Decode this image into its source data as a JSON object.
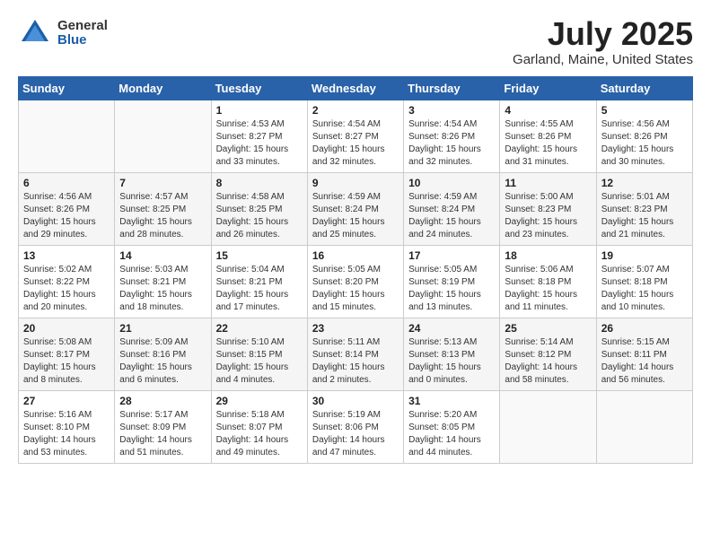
{
  "header": {
    "logo_general": "General",
    "logo_blue": "Blue",
    "title": "July 2025",
    "subtitle": "Garland, Maine, United States"
  },
  "days_of_week": [
    "Sunday",
    "Monday",
    "Tuesday",
    "Wednesday",
    "Thursday",
    "Friday",
    "Saturday"
  ],
  "weeks": [
    [
      {
        "day": null,
        "content": null
      },
      {
        "day": null,
        "content": null
      },
      {
        "day": "1",
        "content": "Sunrise: 4:53 AM\nSunset: 8:27 PM\nDaylight: 15 hours and 33 minutes."
      },
      {
        "day": "2",
        "content": "Sunrise: 4:54 AM\nSunset: 8:27 PM\nDaylight: 15 hours and 32 minutes."
      },
      {
        "day": "3",
        "content": "Sunrise: 4:54 AM\nSunset: 8:26 PM\nDaylight: 15 hours and 32 minutes."
      },
      {
        "day": "4",
        "content": "Sunrise: 4:55 AM\nSunset: 8:26 PM\nDaylight: 15 hours and 31 minutes."
      },
      {
        "day": "5",
        "content": "Sunrise: 4:56 AM\nSunset: 8:26 PM\nDaylight: 15 hours and 30 minutes."
      }
    ],
    [
      {
        "day": "6",
        "content": "Sunrise: 4:56 AM\nSunset: 8:26 PM\nDaylight: 15 hours and 29 minutes."
      },
      {
        "day": "7",
        "content": "Sunrise: 4:57 AM\nSunset: 8:25 PM\nDaylight: 15 hours and 28 minutes."
      },
      {
        "day": "8",
        "content": "Sunrise: 4:58 AM\nSunset: 8:25 PM\nDaylight: 15 hours and 26 minutes."
      },
      {
        "day": "9",
        "content": "Sunrise: 4:59 AM\nSunset: 8:24 PM\nDaylight: 15 hours and 25 minutes."
      },
      {
        "day": "10",
        "content": "Sunrise: 4:59 AM\nSunset: 8:24 PM\nDaylight: 15 hours and 24 minutes."
      },
      {
        "day": "11",
        "content": "Sunrise: 5:00 AM\nSunset: 8:23 PM\nDaylight: 15 hours and 23 minutes."
      },
      {
        "day": "12",
        "content": "Sunrise: 5:01 AM\nSunset: 8:23 PM\nDaylight: 15 hours and 21 minutes."
      }
    ],
    [
      {
        "day": "13",
        "content": "Sunrise: 5:02 AM\nSunset: 8:22 PM\nDaylight: 15 hours and 20 minutes."
      },
      {
        "day": "14",
        "content": "Sunrise: 5:03 AM\nSunset: 8:21 PM\nDaylight: 15 hours and 18 minutes."
      },
      {
        "day": "15",
        "content": "Sunrise: 5:04 AM\nSunset: 8:21 PM\nDaylight: 15 hours and 17 minutes."
      },
      {
        "day": "16",
        "content": "Sunrise: 5:05 AM\nSunset: 8:20 PM\nDaylight: 15 hours and 15 minutes."
      },
      {
        "day": "17",
        "content": "Sunrise: 5:05 AM\nSunset: 8:19 PM\nDaylight: 15 hours and 13 minutes."
      },
      {
        "day": "18",
        "content": "Sunrise: 5:06 AM\nSunset: 8:18 PM\nDaylight: 15 hours and 11 minutes."
      },
      {
        "day": "19",
        "content": "Sunrise: 5:07 AM\nSunset: 8:18 PM\nDaylight: 15 hours and 10 minutes."
      }
    ],
    [
      {
        "day": "20",
        "content": "Sunrise: 5:08 AM\nSunset: 8:17 PM\nDaylight: 15 hours and 8 minutes."
      },
      {
        "day": "21",
        "content": "Sunrise: 5:09 AM\nSunset: 8:16 PM\nDaylight: 15 hours and 6 minutes."
      },
      {
        "day": "22",
        "content": "Sunrise: 5:10 AM\nSunset: 8:15 PM\nDaylight: 15 hours and 4 minutes."
      },
      {
        "day": "23",
        "content": "Sunrise: 5:11 AM\nSunset: 8:14 PM\nDaylight: 15 hours and 2 minutes."
      },
      {
        "day": "24",
        "content": "Sunrise: 5:13 AM\nSunset: 8:13 PM\nDaylight: 15 hours and 0 minutes."
      },
      {
        "day": "25",
        "content": "Sunrise: 5:14 AM\nSunset: 8:12 PM\nDaylight: 14 hours and 58 minutes."
      },
      {
        "day": "26",
        "content": "Sunrise: 5:15 AM\nSunset: 8:11 PM\nDaylight: 14 hours and 56 minutes."
      }
    ],
    [
      {
        "day": "27",
        "content": "Sunrise: 5:16 AM\nSunset: 8:10 PM\nDaylight: 14 hours and 53 minutes."
      },
      {
        "day": "28",
        "content": "Sunrise: 5:17 AM\nSunset: 8:09 PM\nDaylight: 14 hours and 51 minutes."
      },
      {
        "day": "29",
        "content": "Sunrise: 5:18 AM\nSunset: 8:07 PM\nDaylight: 14 hours and 49 minutes."
      },
      {
        "day": "30",
        "content": "Sunrise: 5:19 AM\nSunset: 8:06 PM\nDaylight: 14 hours and 47 minutes."
      },
      {
        "day": "31",
        "content": "Sunrise: 5:20 AM\nSunset: 8:05 PM\nDaylight: 14 hours and 44 minutes."
      },
      {
        "day": null,
        "content": null
      },
      {
        "day": null,
        "content": null
      }
    ]
  ]
}
